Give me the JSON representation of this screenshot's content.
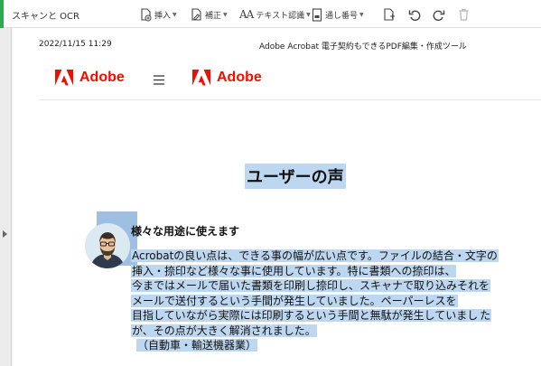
{
  "toolbar": {
    "title": "スキャンと OCR",
    "insert_label": "挿入",
    "correct_label": "補正",
    "text_recognition_label": "テキスト認識",
    "bates_label": "通し番号",
    "text_icon_glyph": "AA",
    "accent_color": "#2fa84f"
  },
  "document": {
    "date": "2022/11/15 11:29",
    "header_title": "Adobe Acrobat 電子契約もできるPDF編集・作成ツール",
    "brand": "Adobe",
    "brand_color": "#eb1000",
    "section_title": "ユーザーの声",
    "testimonial_heading": "様々な用途に使えます",
    "testimonial_lines": [
      "Acrobatの良い点は、できる事の幅が広い点です。ファイルの結合・文字の",
      "挿入・捺印など様々な事に使用しています。特に書類への捺印は、",
      "今まではメールで届いた書類を印刷し捺印し、スキャナで取り込みそれを",
      "メールで送付するという手間が発生していました。ペーパーレスを",
      "目指していながら実際には印刷するという手間と無駄が発生していまし",
      "た",
      "が、その点が大きく解消されました。",
      "（自動車・輸送機器業）"
    ],
    "highlight_color": "#bcd7ef"
  }
}
